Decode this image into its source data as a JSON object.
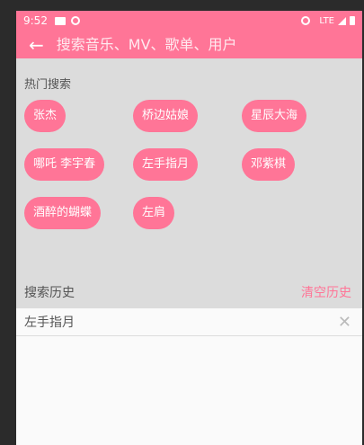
{
  "statusbar": {
    "time": "9:52",
    "network": "LTE"
  },
  "search": {
    "placeholder": "搜索音乐、MV、歌单、用户"
  },
  "hot": {
    "title": "热门搜索",
    "tags": [
      "张杰",
      "桥边姑娘",
      "星辰大海",
      "哪吒 李宇春",
      "左手指月",
      "邓紫棋",
      "酒醉的蝴蝶",
      "左肩"
    ]
  },
  "history": {
    "title": "搜索历史",
    "clear_label": "清空历史",
    "items": [
      "左手指月"
    ]
  },
  "colors": {
    "accent": "#ff7597",
    "panel": "#dcdcdc"
  }
}
